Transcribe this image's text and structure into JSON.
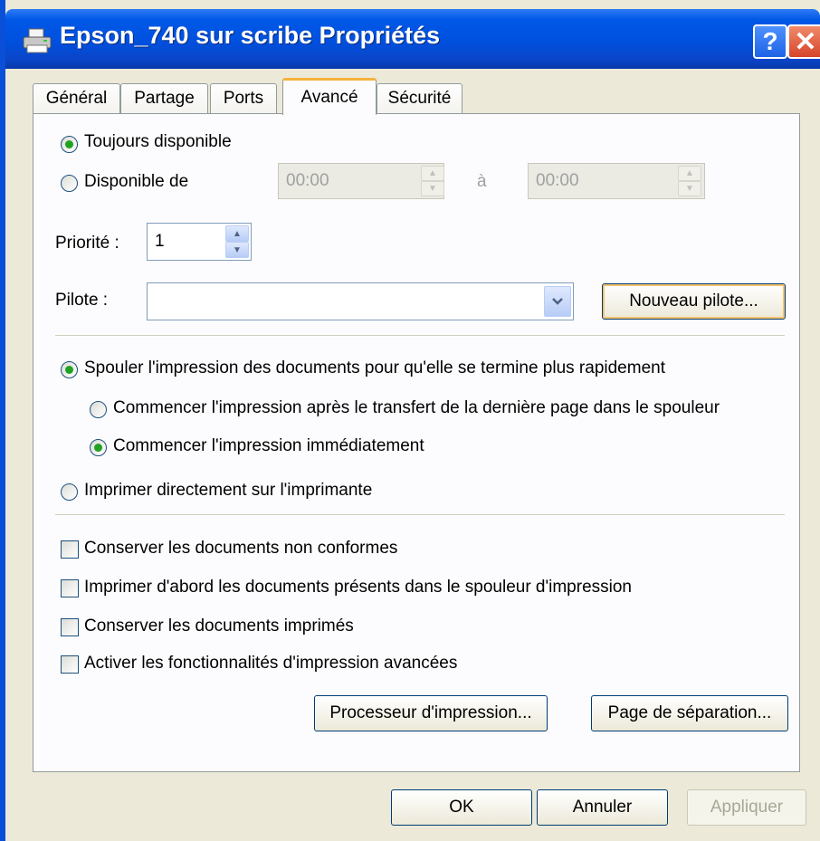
{
  "window": {
    "title": "Epson_740 sur scribe Propriétés",
    "help_label": "?",
    "close_label": "✕"
  },
  "tabs": [
    {
      "label": "Général"
    },
    {
      "label": "Partage"
    },
    {
      "label": "Ports"
    },
    {
      "label": "Avancé",
      "active": true
    },
    {
      "label": "Sécurité"
    }
  ],
  "availability": {
    "always_label": "Toujours disponible",
    "from_label": "Disponible de",
    "from_time": "00:00",
    "to_label": "à",
    "to_time": "00:00",
    "selected": "always"
  },
  "priority": {
    "label": "Priorité :",
    "value": "1"
  },
  "driver": {
    "label": "Pilote :",
    "value": "",
    "new_driver_button": "Nouveau pilote..."
  },
  "spool": {
    "spool_label": "Spouler l'impression des documents pour qu'elle se termine plus rapidement",
    "after_last_page_label": "Commencer l'impression après le transfert de la dernière page dans le spouleur",
    "immediately_label": "Commencer l'impression immédiatement",
    "direct_label": "Imprimer directement sur l'imprimante",
    "selected": "spool",
    "sub_selected": "immediately"
  },
  "options": [
    {
      "label": "Conserver les documents non conformes",
      "checked": false
    },
    {
      "label": "Imprimer d'abord les documents présents dans le spouleur d'impression",
      "checked": false
    },
    {
      "label": "Conserver les documents imprimés",
      "checked": false
    },
    {
      "label": "Activer les fonctionnalités d'impression avancées",
      "checked": false
    }
  ],
  "panel_buttons": {
    "print_processor": "Processeur d'impression...",
    "separator_page": "Page de séparation..."
  },
  "dialog_buttons": {
    "ok": "OK",
    "cancel": "Annuler",
    "apply": "Appliquer"
  }
}
